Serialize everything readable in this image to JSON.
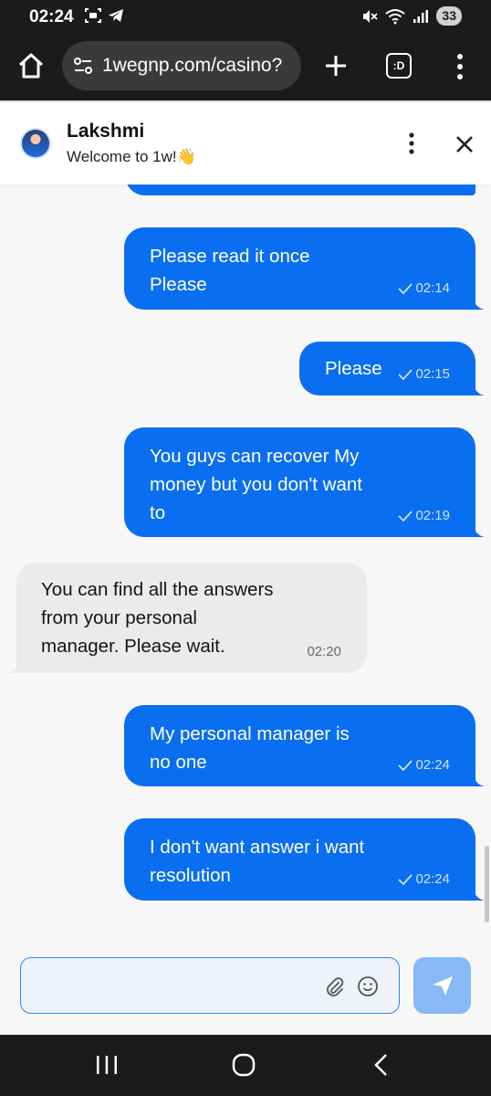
{
  "status_bar": {
    "time": "02:24",
    "battery": "33"
  },
  "browser": {
    "url": "1wegnp.com/casino?",
    "tabs_label": ":D"
  },
  "chat_header": {
    "agent_name": "Lakshmi",
    "subtitle": "Welcome to 1w!👋"
  },
  "messages": [
    {
      "direction": "out",
      "text": "Please read it once\nPlease",
      "time": "02:14",
      "status": "sent"
    },
    {
      "direction": "out",
      "text": "Please",
      "time": "02:15",
      "status": "sent"
    },
    {
      "direction": "out",
      "text": "You guys can recover My\nmoney but you don't want\nto",
      "time": "02:19",
      "status": "sent"
    },
    {
      "direction": "in",
      "text": "You can find all the answers\nfrom your personal\nmanager. Please wait.",
      "time": "02:20"
    },
    {
      "direction": "out",
      "text": "My personal manager is\nno one",
      "time": "02:24",
      "status": "sent"
    },
    {
      "direction": "out",
      "text": "I don't want answer i want\nresolution",
      "time": "02:24",
      "status": "sent"
    }
  ],
  "composer": {
    "value": "",
    "placeholder": ""
  },
  "colors": {
    "outgoing_bubble": "#0a6ef0",
    "incoming_bubble": "#ebebeb",
    "send_button": "#86b9f5",
    "system_bar": "#1b1b1b"
  }
}
